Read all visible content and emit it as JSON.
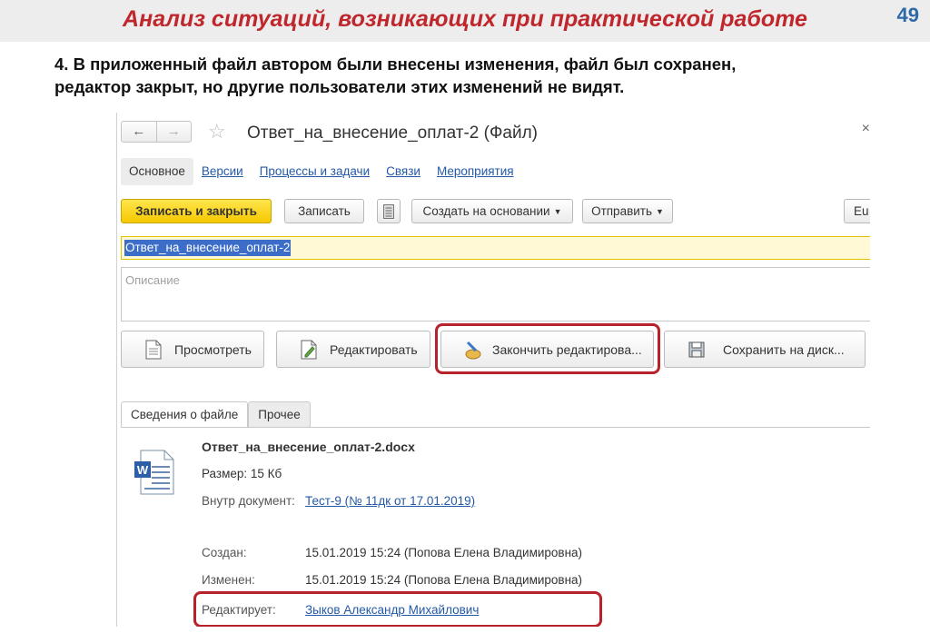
{
  "slide": {
    "title": "Анализ ситуаций, возникающих при практической работе",
    "page_number": "49",
    "text_line1": "4. В приложенный файл автором были внесены изменения, файл был сохранен,",
    "text_line2": "редактор закрыт, но другие пользователи этих изменений не видят."
  },
  "window": {
    "back": "←",
    "forward": "→",
    "star": "☆",
    "title": "Ответ_на_внесение_оплат-2 (Файл)",
    "close": "×"
  },
  "tabs": [
    {
      "label": "Основное"
    },
    {
      "label": "Версии"
    },
    {
      "label": "Процессы и задачи"
    },
    {
      "label": "Связи"
    },
    {
      "label": "Мероприятия"
    }
  ],
  "toolbar": {
    "save_close": "Записать и закрыть",
    "save": "Записать",
    "create_based": "Создать на основании",
    "send": "Отправить",
    "eu": "Eu"
  },
  "name_field": {
    "value": "Ответ_на_внесение_оплат-2"
  },
  "description": {
    "placeholder": "Описание"
  },
  "actions": {
    "view": "Просмотреть",
    "edit": "Редактировать",
    "finish_edit": "Закончить редактирова...",
    "save_disk": "Сохранить на диск..."
  },
  "file_tabs": [
    {
      "label": "Сведения о файле"
    },
    {
      "label": "Прочее"
    }
  ],
  "file_info": {
    "name": "Ответ_на_внесение_оплат-2.docx",
    "size": "Размер: 15 Кб",
    "inside_label": "Внутр документ:",
    "inside_value": "Тест-9 (№ 11дк от 17.01.2019)",
    "created_label": "Создан:",
    "created_value": "15.01.2019 15:24 (Попова Елена Владимировна)",
    "modified_label": "Изменен:",
    "modified_value": "15.01.2019 15:24 (Попова Елена Владимировна)",
    "editing_label": "Редактирует:",
    "editing_value": "Зыков Александр Михайлович"
  },
  "colors": {
    "title_red": "#c0272d",
    "page_number_blue": "#2e6aa8",
    "primary_yellow": "#f5c800",
    "highlight_box": "#b8232b",
    "link_blue": "#2459a8"
  }
}
